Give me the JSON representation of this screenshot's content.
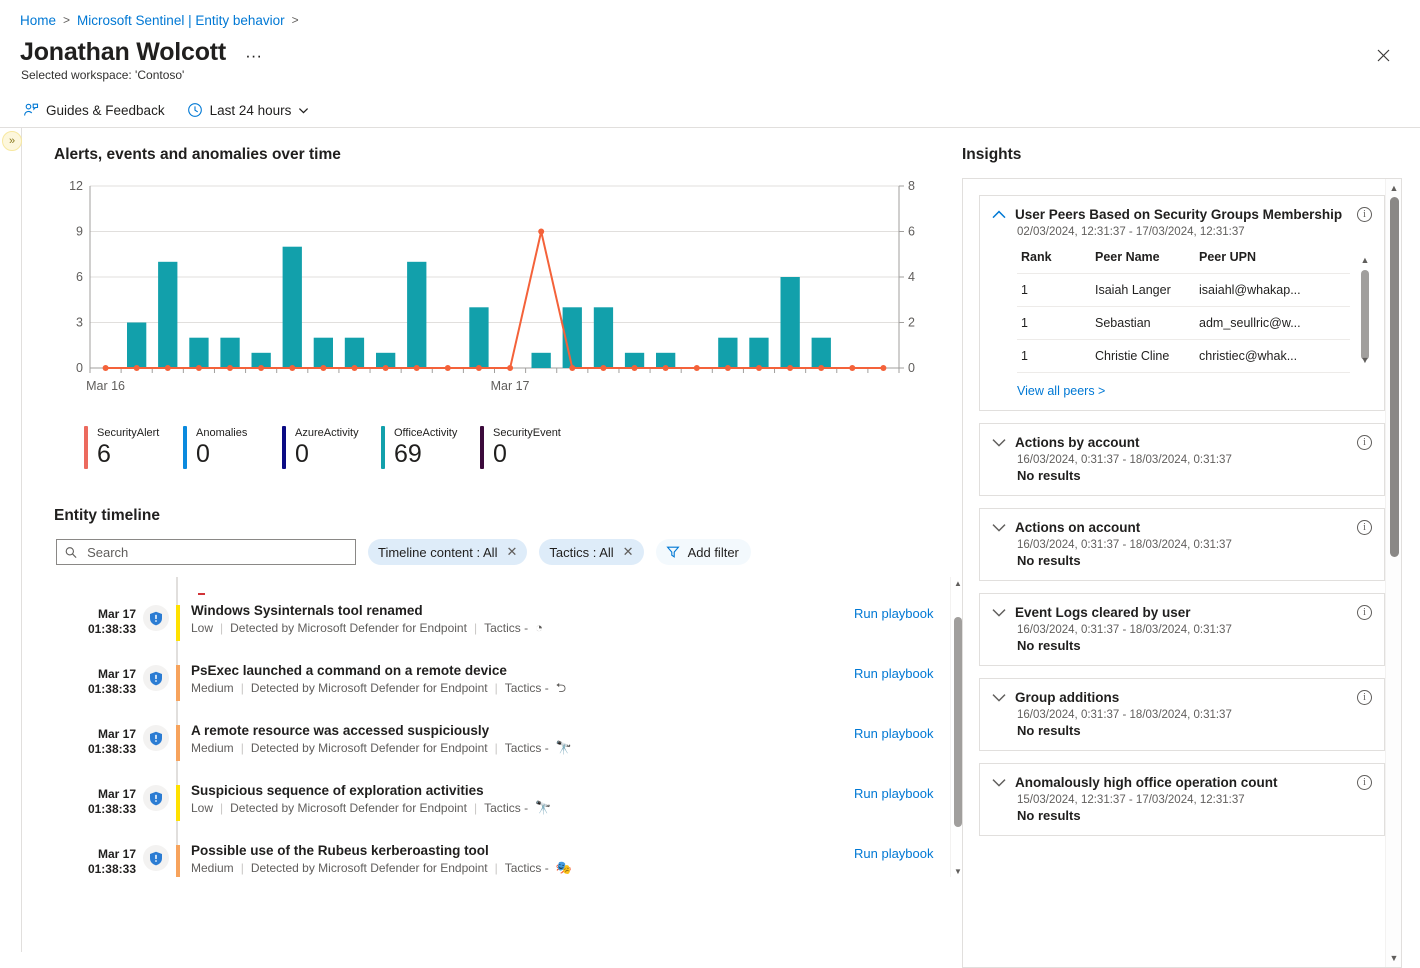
{
  "breadcrumb": {
    "items": [
      {
        "label": "Home"
      },
      {
        "label": "Microsoft Sentinel | Entity behavior"
      }
    ],
    "separator": ">"
  },
  "header": {
    "title": "Jonathan Wolcott",
    "ellipsis": "···",
    "subtitle": "Selected workspace: 'Contoso'",
    "close_icon": "close-icon"
  },
  "command_bar": {
    "guides_label": "Guides & Feedback",
    "time_range_label": "Last 24 hours",
    "chevron": "⌄"
  },
  "left_rail": {
    "expand_icon": "»"
  },
  "chart_panel": {
    "title": "Alerts, events and anomalies over time"
  },
  "chart_data": {
    "type": "bar",
    "title": "Alerts, events and anomalies over time",
    "xlabel": "",
    "ylabel": "",
    "grid": true,
    "ylim": [
      0,
      12
    ],
    "y_ticks": [
      0,
      3,
      6,
      9,
      12
    ],
    "y2lim": [
      0,
      8
    ],
    "y2_ticks": [
      0,
      2,
      4,
      6,
      8
    ],
    "x_tick_labels": [
      "Mar 16",
      "Mar 17"
    ],
    "x_tick_positions": [
      0,
      13
    ],
    "categories": [
      "0",
      "1",
      "2",
      "3",
      "4",
      "5",
      "6",
      "7",
      "8",
      "9",
      "10",
      "11",
      "12",
      "13",
      "14",
      "15",
      "16",
      "17",
      "18",
      "19",
      "20",
      "21",
      "22",
      "23",
      "24",
      "25"
    ],
    "series": [
      {
        "name": "events",
        "type": "bar",
        "axis": "left",
        "color": "#12a0ab",
        "values": [
          0,
          3,
          7,
          2,
          2,
          1,
          8,
          2,
          2,
          1,
          7,
          0,
          4,
          0,
          1,
          4,
          4,
          1,
          1,
          0,
          2,
          2,
          6,
          2,
          0,
          0
        ]
      },
      {
        "name": "anomalies-line",
        "type": "line",
        "axis": "right",
        "color": "#f4623a",
        "values": [
          0,
          0,
          0,
          0,
          0,
          0,
          0,
          0,
          0,
          0,
          0,
          0,
          0,
          0,
          6,
          0,
          0,
          0,
          0,
          0,
          0,
          0,
          0,
          0,
          0,
          0
        ]
      }
    ]
  },
  "metrics": [
    {
      "label": "SecurityAlert",
      "value": "6",
      "color": "#ec6a5e"
    },
    {
      "label": "Anomalies",
      "value": "0",
      "color": "#0b8ade"
    },
    {
      "label": "AzureActivity",
      "value": "0",
      "color": "#0b0b84"
    },
    {
      "label": "OfficeActivity",
      "value": "69",
      "color": "#12a0ab"
    },
    {
      "label": "SecurityEvent",
      "value": "0",
      "color": "#3b0a3b"
    }
  ],
  "entity_timeline": {
    "title": "Entity timeline",
    "search": {
      "placeholder": "Search",
      "value": ""
    },
    "filters": [
      {
        "label": "Timeline content : All",
        "remove": "✕"
      },
      {
        "label": "Tactics : All",
        "remove": "✕"
      }
    ],
    "add_filter_label": "Add filter",
    "playbook_label": "Run playbook",
    "tactics_prefix": "Tactics -",
    "rows": [
      {
        "date": "Mar 17",
        "time": "01:38:33",
        "title": "Windows Sysinternals tool renamed",
        "severity": "Low",
        "severity_color": "#ffe100",
        "source": "Detected by Microsoft Defender for Endpoint",
        "tactic_icon": "defense-evasion-icon",
        "tactic_glyph": "◔"
      },
      {
        "date": "Mar 17",
        "time": "01:38:33",
        "title": "PsExec launched a command on a remote device",
        "severity": "Medium",
        "severity_color": "#f7a35c",
        "source": "Detected by Microsoft Defender for Endpoint",
        "tactic_icon": "lateral-movement-icon",
        "tactic_glyph": "⮌"
      },
      {
        "date": "Mar 17",
        "time": "01:38:33",
        "title": "A remote resource was accessed suspiciously",
        "severity": "Medium",
        "severity_color": "#f7a35c",
        "source": "Detected by Microsoft Defender for Endpoint",
        "tactic_icon": "discovery-icon",
        "tactic_glyph": "🔭"
      },
      {
        "date": "Mar 17",
        "time": "01:38:33",
        "title": "Suspicious sequence of exploration activities",
        "severity": "Low",
        "severity_color": "#ffe100",
        "source": "Detected by Microsoft Defender for Endpoint",
        "tactic_icon": "discovery-icon",
        "tactic_glyph": "🔭"
      },
      {
        "date": "Mar 17",
        "time": "01:38:33",
        "title": "Possible use of the Rubeus kerberoasting tool",
        "severity": "Medium",
        "severity_color": "#f7a35c",
        "source": "Detected by Microsoft Defender for Endpoint",
        "tactic_icon": "credential-access-icon",
        "tactic_glyph": "🎭"
      }
    ]
  },
  "insights": {
    "title": "Insights",
    "cards": [
      {
        "name": "user-peers",
        "title": "User Peers Based on Security Groups Membership",
        "range": "02/03/2024, 12:31:37 - 17/03/2024, 12:31:37",
        "expanded": true,
        "table": {
          "columns": [
            "Rank",
            "Peer Name",
            "Peer UPN"
          ],
          "rows": [
            [
              "1",
              "Isaiah Langer",
              "isaiahl@whakap..."
            ],
            [
              "1",
              "Sebastian",
              "adm_seullric@w..."
            ],
            [
              "1",
              "Christie Cline",
              "christiec@whak..."
            ]
          ]
        },
        "link": "View all peers >"
      },
      {
        "name": "actions-by-account",
        "title": "Actions by account",
        "range": "16/03/2024, 0:31:37 - 18/03/2024, 0:31:37",
        "expanded": false,
        "result": "No results"
      },
      {
        "name": "actions-on-account",
        "title": "Actions on account",
        "range": "16/03/2024, 0:31:37 - 18/03/2024, 0:31:37",
        "expanded": false,
        "result": "No results"
      },
      {
        "name": "event-logs-cleared",
        "title": "Event Logs cleared by user",
        "range": "16/03/2024, 0:31:37 - 18/03/2024, 0:31:37",
        "expanded": false,
        "result": "No results"
      },
      {
        "name": "group-additions",
        "title": "Group additions",
        "range": "16/03/2024, 0:31:37 - 18/03/2024, 0:31:37",
        "expanded": false,
        "result": "No results"
      },
      {
        "name": "anomalous-office-ops",
        "title": "Anomalously high office operation count",
        "range": "15/03/2024, 12:31:37 - 17/03/2024, 12:31:37",
        "expanded": false,
        "result": "No results"
      }
    ]
  }
}
